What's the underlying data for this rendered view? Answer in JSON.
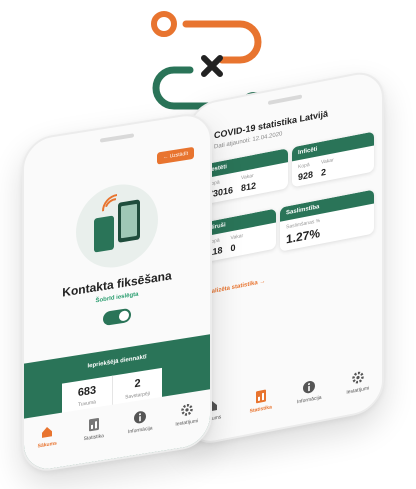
{
  "colors": {
    "brand_green": "#2a7458",
    "brand_orange": "#e8742f",
    "accent_green": "#2a9d6f"
  },
  "logo": {
    "icon": "connect-x-logo"
  },
  "stats_phone": {
    "title": "COVID-19 statistika Latvijā",
    "date": "Dati atjaunoti: 12.04.2020",
    "cards": [
      {
        "header": "Testēti",
        "cells": [
          {
            "label": "Kopā",
            "value": "73016"
          },
          {
            "label": "Vakar",
            "value": "812"
          }
        ]
      },
      {
        "header": "Inficēti",
        "cells": [
          {
            "label": "Kopā",
            "value": "928"
          },
          {
            "label": "Vakar",
            "value": "2"
          }
        ]
      },
      {
        "header": "Miruši",
        "cells": [
          {
            "label": "Kopā",
            "value": "118"
          },
          {
            "label": "Vakar",
            "value": "0"
          }
        ]
      },
      {
        "header": "Saslimstība",
        "cells": [
          {
            "label": "Saslimšanas %",
            "value": "1.27%"
          }
        ]
      }
    ],
    "link": "Detalizēta statistika  →",
    "tabs": [
      {
        "label": "Sākums",
        "icon": "home-icon"
      },
      {
        "label": "Statistika",
        "icon": "chart-icon"
      },
      {
        "label": "Informācija",
        "icon": "info-icon"
      },
      {
        "label": "Iestatījumi",
        "icon": "gear-icon"
      }
    ]
  },
  "contact_phone": {
    "back_label": "← Uzstādīt",
    "title": "Kontakta fiksēšana",
    "status": "Šobrīd ieslēgta",
    "panel_title": "Iepriekšējā diennaktī",
    "boxes": [
      {
        "number": "683",
        "label": "Tuvumā"
      },
      {
        "number": "2",
        "label": "Savstarpēji"
      }
    ],
    "tabs": [
      {
        "label": "Sākums",
        "icon": "home-icon"
      },
      {
        "label": "Statistika",
        "icon": "chart-icon"
      },
      {
        "label": "Informācija",
        "icon": "info-icon"
      },
      {
        "label": "Iestatījumi",
        "icon": "gear-icon"
      }
    ]
  }
}
